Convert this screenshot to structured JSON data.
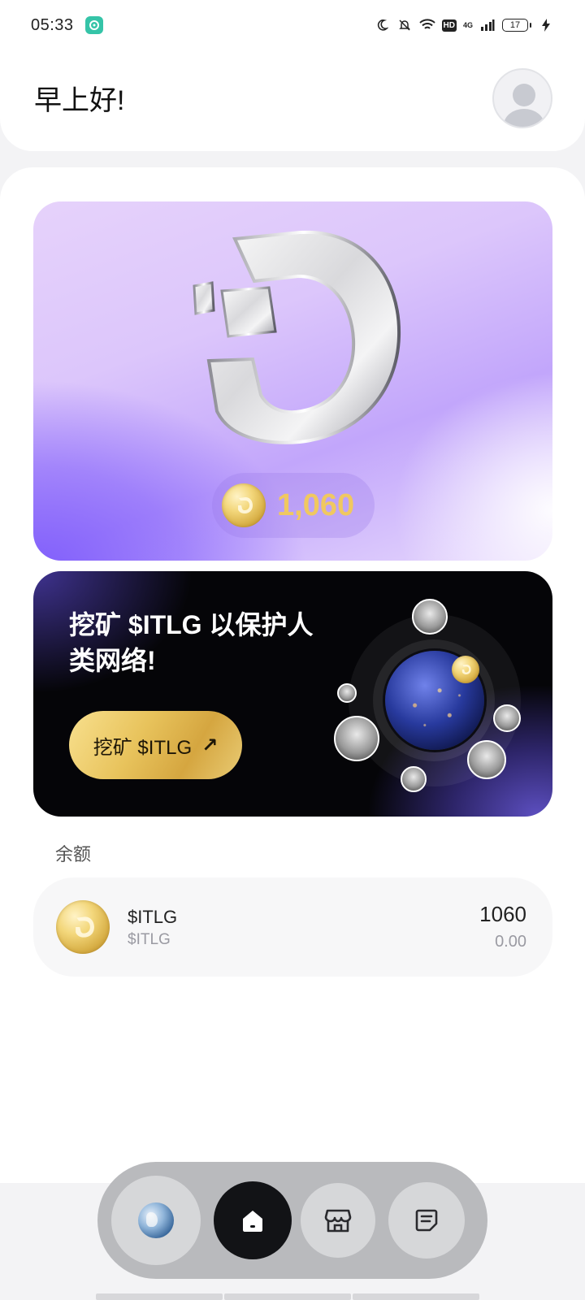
{
  "status_bar": {
    "time": "05:33",
    "battery": "17",
    "network": "4G",
    "hd_label": "HD"
  },
  "header": {
    "greeting": "早上好!"
  },
  "hero": {
    "amount": "1,060"
  },
  "mining_banner": {
    "title": "挖矿 $ITLG 以保护人类网络!",
    "button_label": "挖矿 $ITLG",
    "button_arrow": "↗"
  },
  "balance": {
    "section_label": "余额",
    "assets": [
      {
        "name": "$ITLG",
        "symbol": "$ITLG",
        "amount": "1060",
        "value": "0.00"
      }
    ]
  },
  "bottom_nav": {
    "items": [
      {
        "icon": "globe-icon"
      },
      {
        "icon": "home-icon",
        "active": true
      },
      {
        "icon": "store-icon"
      },
      {
        "icon": "document-icon"
      }
    ]
  },
  "colors": {
    "accent_gold": "#f0c860",
    "hero_purple": "#7f5dfb",
    "nav_active": "#121316"
  }
}
